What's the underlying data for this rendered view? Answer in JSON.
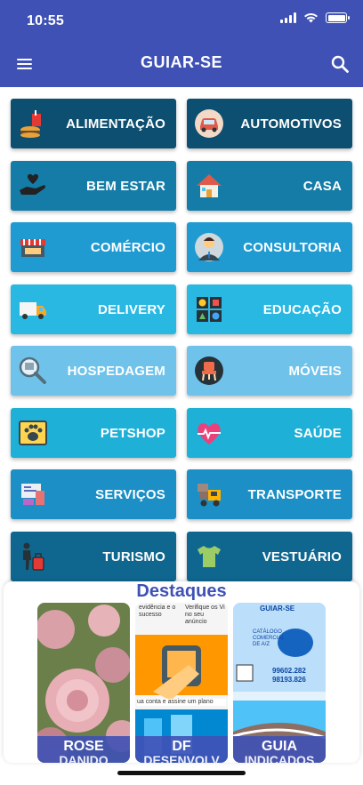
{
  "status_bar": {
    "time": "10:55"
  },
  "app_bar": {
    "title": "GUIAR-SE",
    "menu_icon": "menu-icon",
    "search_icon": "search-icon"
  },
  "categories": [
    {
      "label": "ALIMENTAÇÃO",
      "icon": "food-icon",
      "color": "#0d4f70"
    },
    {
      "label": "AUTOMOTIVOS",
      "icon": "car-icon",
      "color": "#0d4f70"
    },
    {
      "label": "BEM ESTAR",
      "icon": "heart-hand-icon",
      "color": "#157ca8"
    },
    {
      "label": "CASA",
      "icon": "house-icon",
      "color": "#157ca8"
    },
    {
      "label": "COMÉRCIO",
      "icon": "shop-icon",
      "color": "#1f9bd2"
    },
    {
      "label": "CONSULTORIA",
      "icon": "consultant-icon",
      "color": "#1f9bd2"
    },
    {
      "label": "DELIVERY",
      "icon": "truck-icon",
      "color": "#29b8e2"
    },
    {
      "label": "EDUCAÇÃO",
      "icon": "blocks-icon",
      "color": "#29b8e2"
    },
    {
      "label": "HOSPEDAGEM",
      "icon": "magnifier-icon",
      "color": "#6fc3eb"
    },
    {
      "label": "MÓVEIS",
      "icon": "chair-icon",
      "color": "#6fc3eb"
    },
    {
      "label": "PETSHOP",
      "icon": "paw-icon",
      "color": "#1fb0d8"
    },
    {
      "label": "SAÚDE",
      "icon": "health-heart-icon",
      "color": "#1fb0d8"
    },
    {
      "label": "SERVIÇOS",
      "icon": "services-icon",
      "color": "#1b8fc6"
    },
    {
      "label": "TRANSPORTE",
      "icon": "forklift-icon",
      "color": "#1b8fc6"
    },
    {
      "label": "TURISMO",
      "icon": "traveler-icon",
      "color": "#0f6790"
    },
    {
      "label": "VESTUÁRIO",
      "icon": "tshirt-icon",
      "color": "#0f6790"
    }
  ],
  "highlights": {
    "title": "Destaques",
    "cards": [
      {
        "name": "ROSE",
        "sub": "DANIDO"
      },
      {
        "name": "DF",
        "sub": "DESENVOLV"
      },
      {
        "name": "GUIA",
        "sub": "INDICADOS"
      }
    ],
    "card2_texts": [
      "evidência e o sucesso",
      "Verifique os Vi no seu anúncio",
      "ua conta e assine um plano"
    ],
    "card3_texts": [
      "GUIAR-SE",
      "CATÁLOGO COMERCIAL DE A/Z",
      "99602.282",
      "98193.826"
    ]
  }
}
